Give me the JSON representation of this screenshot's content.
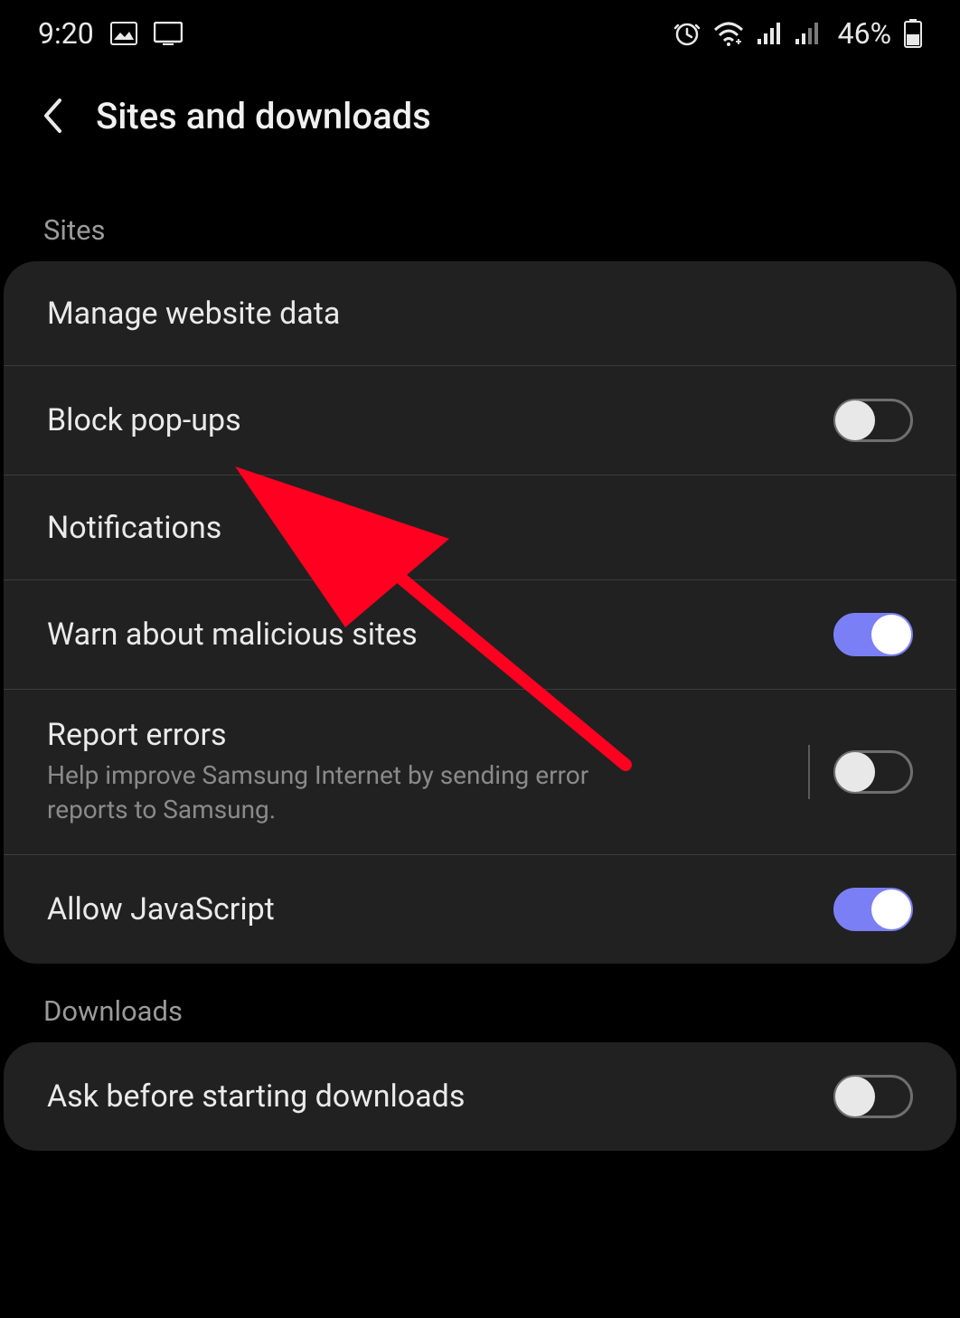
{
  "status": {
    "time": "9:20",
    "battery": "46%"
  },
  "header": {
    "title": "Sites and downloads"
  },
  "sections": {
    "sites": {
      "label": "Sites",
      "items": {
        "manage_data": "Manage website data",
        "block_popups": "Block pop-ups",
        "notifications": "Notifications",
        "malicious": "Warn about malicious sites",
        "report_errors": "Report errors",
        "report_errors_sub": "Help improve Samsung Internet by sending error reports to Samsung.",
        "allow_js": "Allow JavaScript"
      },
      "toggles": {
        "block_popups": false,
        "malicious": true,
        "report_errors": false,
        "allow_js": true
      }
    },
    "downloads": {
      "label": "Downloads",
      "items": {
        "ask_before": "Ask before starting downloads"
      },
      "toggles": {
        "ask_before": false
      }
    }
  }
}
